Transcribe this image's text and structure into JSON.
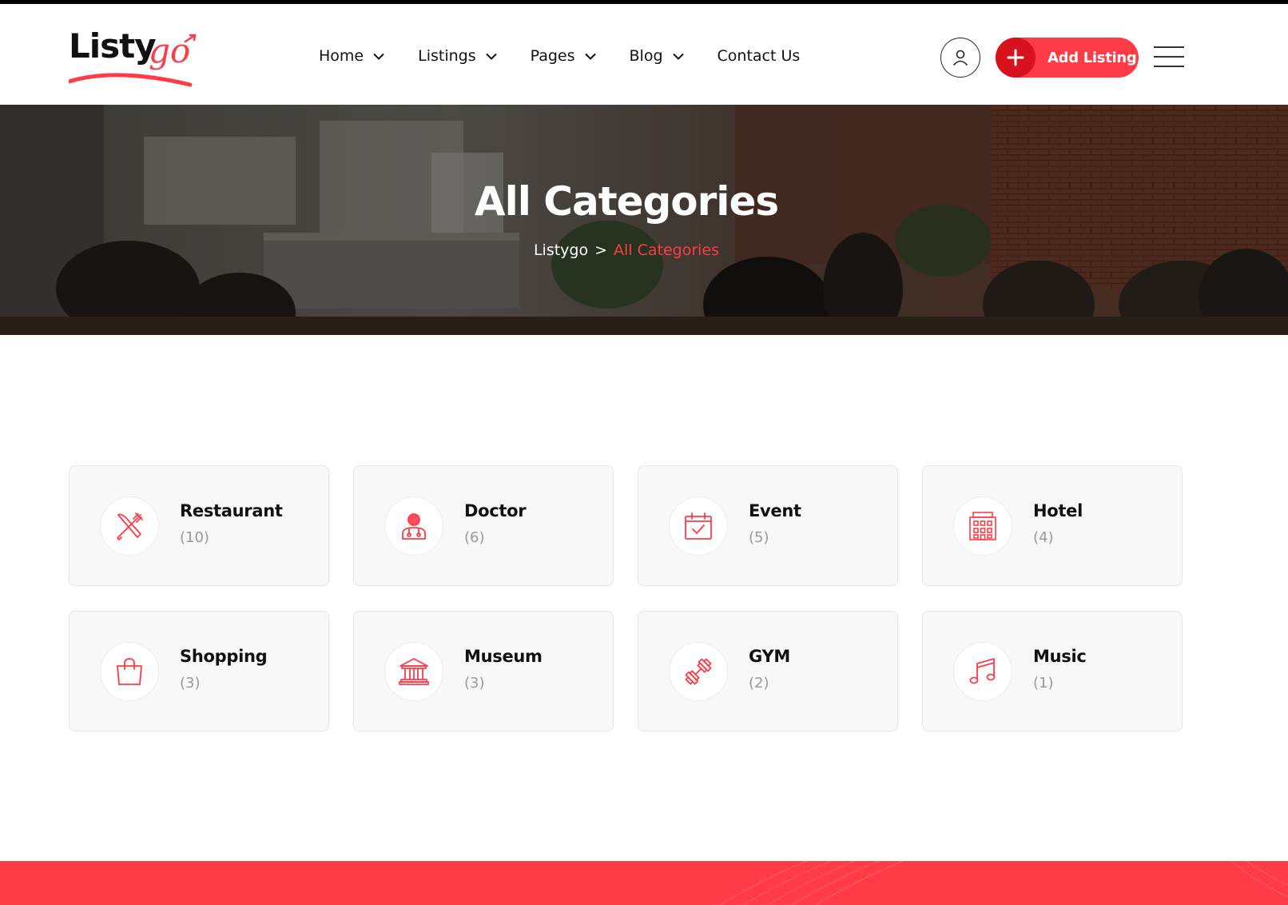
{
  "colors": {
    "accent": "#ff3b46",
    "accent_dark": "#d8121d",
    "text": "#111111",
    "muted": "#999999",
    "card_bg": "#f8f8f8"
  },
  "header": {
    "logo_text": "Listy",
    "logo_script": "go",
    "nav": [
      {
        "label": "Home",
        "has_dropdown": true
      },
      {
        "label": "Listings",
        "has_dropdown": true
      },
      {
        "label": "Pages",
        "has_dropdown": true
      },
      {
        "label": "Blog",
        "has_dropdown": true
      },
      {
        "label": "Contact Us",
        "has_dropdown": false
      }
    ],
    "user_icon": "user-icon",
    "add_listing_label": "Add Listing",
    "menu_icon": "hamburger-icon"
  },
  "hero": {
    "title": "All Categories",
    "breadcrumb": {
      "home": "Listygo",
      "separator": ">",
      "current": "All Categories"
    }
  },
  "categories": [
    {
      "name": "Restaurant",
      "count": "(10)",
      "icon": "fork-knife-icon"
    },
    {
      "name": "Doctor",
      "count": "(6)",
      "icon": "doctor-icon"
    },
    {
      "name": "Event",
      "count": "(5)",
      "icon": "calendar-check-icon"
    },
    {
      "name": "Hotel",
      "count": "(4)",
      "icon": "hotel-icon"
    },
    {
      "name": "Shopping",
      "count": "(3)",
      "icon": "shopping-bag-icon"
    },
    {
      "name": "Museum",
      "count": "(3)",
      "icon": "museum-icon"
    },
    {
      "name": "GYM",
      "count": "(2)",
      "icon": "dumbbell-icon"
    },
    {
      "name": "Music",
      "count": "(1)",
      "icon": "music-note-icon"
    }
  ]
}
